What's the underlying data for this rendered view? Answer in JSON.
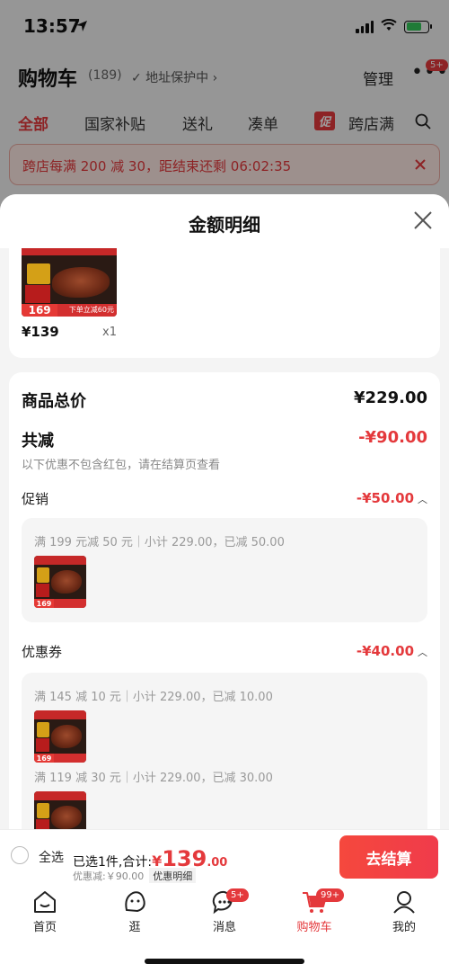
{
  "status": {
    "time": "13:57"
  },
  "cart": {
    "title": "购物车",
    "count": "(189)",
    "address_protect": "✓ 地址保护中 ›",
    "manage": "管理",
    "more_badge": "5+",
    "tabs": [
      "全部",
      "国家补贴",
      "送礼",
      "凑单",
      "跨店满"
    ],
    "promo_tag": "促",
    "promo_bar": "跨店每满 200 减 30，距结束还剩 06:02:35"
  },
  "sheet": {
    "title": "金额明细",
    "product": {
      "price": "¥139",
      "qty": "x1",
      "thumb_price": "169",
      "thumb_banner": "下单立减60元"
    },
    "total_label": "商品总价",
    "total_value": "¥229.00",
    "reduce_label": "共减",
    "reduce_value": "-¥90.00",
    "note": "以下优惠不包含红包，请在结算页查看",
    "promo": {
      "label": "促销",
      "value": "-¥50.00",
      "line": "满 199 元减 50 元｜小计 229.00，已减 50.00",
      "thumb_price": "169"
    },
    "coupon": {
      "label": "优惠券",
      "value": "-¥40.00",
      "line1": "满 145 减 10 元｜小计 229.00，已减 10.00",
      "line2": "满 119 减 30 元｜小计 229.00，已减 30.00",
      "thumb_price": "169"
    }
  },
  "bottom": {
    "select_all": "全选",
    "selected_text": "已选1件,合计:",
    "yen": "¥",
    "amount": "139",
    "cents": ".00",
    "discount": "优惠减:￥90.00",
    "detail_link": "优惠明细",
    "checkout": "去结算"
  },
  "tabbar": {
    "items": [
      {
        "label": "首页",
        "icon": "home-icon"
      },
      {
        "label": "逛",
        "icon": "stroll-icon"
      },
      {
        "label": "消息",
        "icon": "message-icon",
        "badge": "5+"
      },
      {
        "label": "购物车",
        "icon": "cart-icon",
        "badge": "99+"
      },
      {
        "label": "我的",
        "icon": "profile-icon"
      }
    ]
  },
  "colors": {
    "accent": "#e4393c",
    "checkout": "#f5483d",
    "sheet_bg": "#f4f4f4"
  }
}
